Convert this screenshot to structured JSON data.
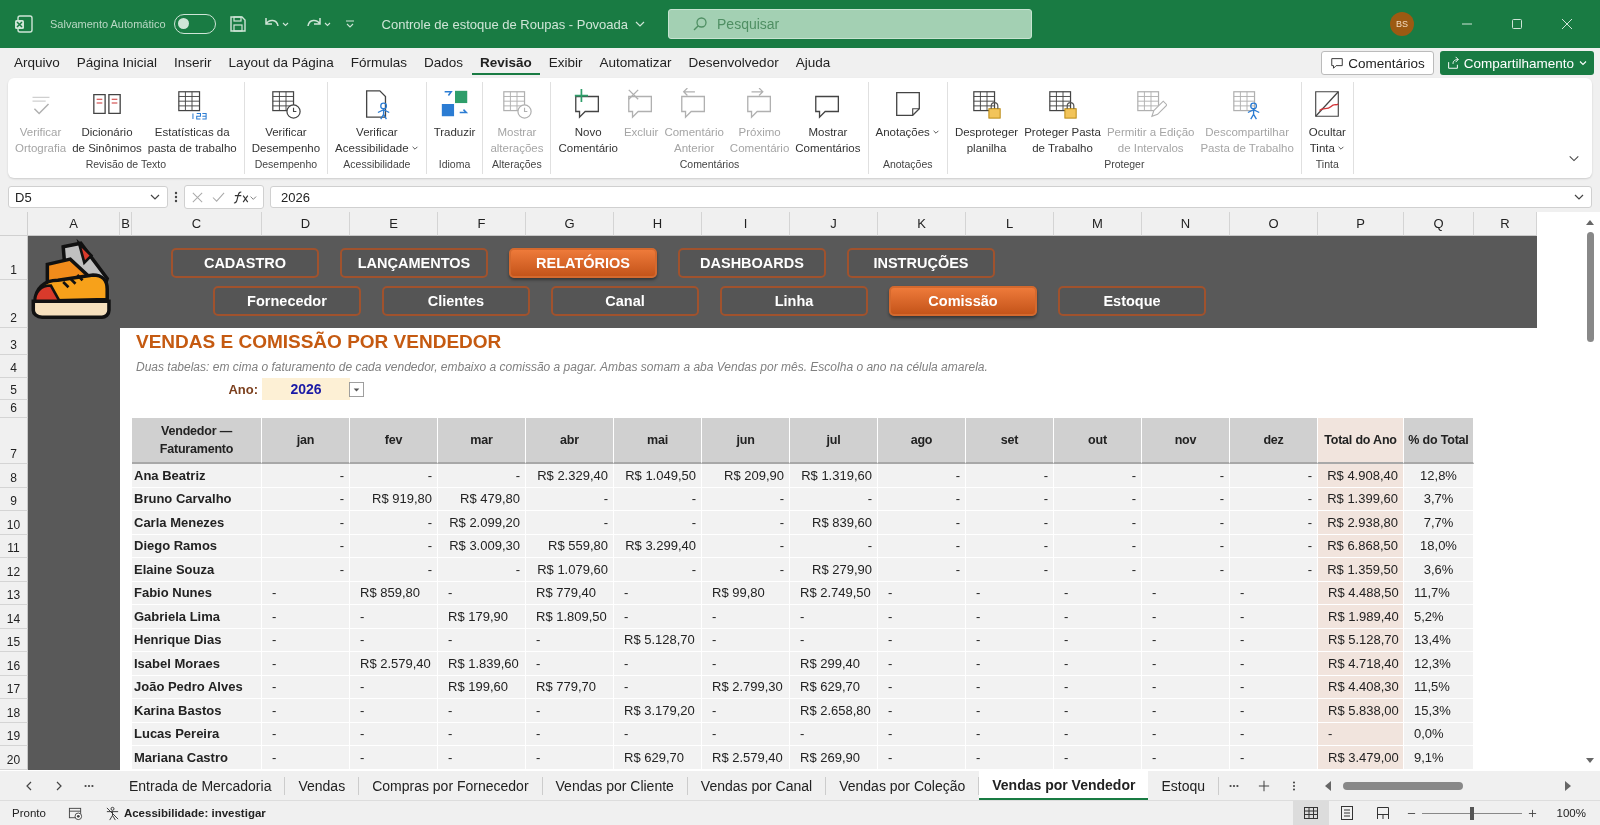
{
  "title_bar": {
    "autosave_label": "Salvamento Automático",
    "autosave_on": false,
    "document_title": "Controle de estoque de Roupas - Povoada",
    "search_placeholder": "Pesquisar",
    "user_initials": "BS"
  },
  "menu": {
    "items": [
      {
        "label": "Arquivo",
        "selected": false
      },
      {
        "label": "Página Inicial",
        "selected": false
      },
      {
        "label": "Inserir",
        "selected": false
      },
      {
        "label": "Layout da Página",
        "selected": false
      },
      {
        "label": "Fórmulas",
        "selected": false
      },
      {
        "label": "Dados",
        "selected": false
      },
      {
        "label": "Revisão",
        "selected": true
      },
      {
        "label": "Exibir",
        "selected": false
      },
      {
        "label": "Automatizar",
        "selected": false
      },
      {
        "label": "Desenvolvedor",
        "selected": false
      },
      {
        "label": "Ajuda",
        "selected": false
      }
    ],
    "comments_button": "Comentários",
    "share_button": "Compartilhamento"
  },
  "ribbon": {
    "groups": [
      {
        "label": "Revisão de Texto",
        "commands": [
          {
            "lines": [
              "Verificar",
              "Ortografia"
            ],
            "kind": "spelling",
            "disabled": true,
            "dropdown": false
          },
          {
            "lines": [
              "Dicionário",
              "de Sinônimos"
            ],
            "kind": "thesaurus",
            "disabled": false,
            "dropdown": false
          },
          {
            "lines": [
              "Estatísticas da",
              "pasta de trabalho"
            ],
            "kind": "statistics",
            "disabled": false,
            "dropdown": false
          }
        ]
      },
      {
        "label": "Desempenho",
        "commands": [
          {
            "lines": [
              "Verificar",
              "Desempenho"
            ],
            "kind": "performance",
            "disabled": false,
            "dropdown": false
          }
        ]
      },
      {
        "label": "Acessibilidade",
        "commands": [
          {
            "lines": [
              "Verificar",
              "Acessibilidade"
            ],
            "kind": "accessibility",
            "disabled": false,
            "dropdown": true
          }
        ]
      },
      {
        "label": "Idioma",
        "commands": [
          {
            "lines": [
              "Traduzir"
            ],
            "kind": "translate",
            "disabled": false,
            "dropdown": false
          }
        ]
      },
      {
        "label": "Alterações",
        "commands": [
          {
            "lines": [
              "Mostrar",
              "alterações"
            ],
            "kind": "changes",
            "disabled": true,
            "dropdown": false
          }
        ]
      },
      {
        "label": "Comentários",
        "commands": [
          {
            "lines": [
              "Novo",
              "Comentário"
            ],
            "kind": "new_comment",
            "disabled": false,
            "dropdown": false
          },
          {
            "lines": [
              "Excluir"
            ],
            "kind": "delete_comment",
            "disabled": true,
            "dropdown": false
          },
          {
            "lines": [
              "Comentário",
              "Anterior"
            ],
            "kind": "previous_comment",
            "disabled": true,
            "dropdown": false
          },
          {
            "lines": [
              "Próximo",
              "Comentário"
            ],
            "kind": "next_comment",
            "disabled": true,
            "dropdown": false
          },
          {
            "lines": [
              "Mostrar",
              "Comentários"
            ],
            "kind": "show_comments",
            "disabled": false,
            "dropdown": false
          }
        ]
      },
      {
        "label": "Anotações",
        "commands": [
          {
            "lines": [
              "Anotações"
            ],
            "kind": "notes",
            "disabled": false,
            "dropdown": true
          }
        ]
      },
      {
        "label": "Proteger",
        "commands": [
          {
            "lines": [
              "Desproteger",
              "planilha"
            ],
            "kind": "unprotect_sheet",
            "disabled": false,
            "dropdown": false
          },
          {
            "lines": [
              "Proteger Pasta",
              "de Trabalho"
            ],
            "kind": "protect_workbook",
            "disabled": false,
            "dropdown": false
          },
          {
            "lines": [
              "Permitir a Edição",
              "de Intervalos"
            ],
            "kind": "allow_edit",
            "disabled": true,
            "dropdown": false
          },
          {
            "lines": [
              "Descompartilhar",
              "Pasta de Trabalho"
            ],
            "kind": "unshare",
            "disabled": true,
            "dropdown": false
          }
        ]
      },
      {
        "label": "Tinta",
        "commands": [
          {
            "lines": [
              "Ocultar",
              "Tinta"
            ],
            "kind": "ink",
            "disabled": false,
            "dropdown": true
          }
        ]
      }
    ]
  },
  "formula_bar": {
    "name_box": "D5",
    "formula": "2026"
  },
  "sheet": {
    "columns": [
      "A",
      "B",
      "C",
      "D",
      "E",
      "F",
      "G",
      "H",
      "I",
      "J",
      "K",
      "L",
      "M",
      "N",
      "O",
      "P",
      "Q",
      "R"
    ],
    "row_numbers": [
      "1",
      "2",
      "3",
      "4",
      "5",
      "6",
      "7",
      "8",
      "9",
      "10",
      "11",
      "12",
      "13",
      "14",
      "15",
      "16",
      "17",
      "18",
      "19",
      "20"
    ],
    "nav_top": [
      {
        "label": "CADASTRO",
        "selected": false
      },
      {
        "label": "LANÇAMENTOS",
        "selected": false
      },
      {
        "label": "RELATÓRIOS",
        "selected": true
      },
      {
        "label": "DASHBOARDS",
        "selected": false
      },
      {
        "label": "INSTRUÇÕES",
        "selected": false
      }
    ],
    "nav_sub": [
      {
        "label": "Fornecedor",
        "selected": false
      },
      {
        "label": "Clientes",
        "selected": false
      },
      {
        "label": "Canal",
        "selected": false
      },
      {
        "label": "Linha",
        "selected": false
      },
      {
        "label": "Comissão",
        "selected": true
      },
      {
        "label": "Estoque",
        "selected": false
      }
    ],
    "heading": "VENDAS E COMISSÃO POR VENDEDOR",
    "note": "Duas tabelas: em cima o faturamento de cada vendedor, embaixo a comissão a pagar. Ambas somam a aba Vendas por mês. Escolha o ano na célula amarela.",
    "year_label": "Ano:",
    "year_value": "2026",
    "table": {
      "columns": [
        "Vendedor — Faturamento",
        "jan",
        "fev",
        "mar",
        "abr",
        "mai",
        "jun",
        "jul",
        "ago",
        "set",
        "out",
        "nov",
        "dez",
        "Total do Ano",
        "% do Total"
      ],
      "rows": [
        {
          "name": "Ana Beatriz",
          "kind": "right",
          "months": [
            "-",
            "-",
            "-",
            "R$ 2.329,40",
            "R$ 1.049,50",
            "R$ 209,90",
            "R$ 1.319,60",
            "-",
            "-",
            "-",
            "-",
            "-"
          ],
          "total": "R$ 4.908,40",
          "share": "12,8%"
        },
        {
          "name": "Bruno Carvalho",
          "kind": "right",
          "months": [
            "-",
            "R$ 919,80",
            "R$ 479,80",
            "-",
            "-",
            "-",
            "-",
            "-",
            "-",
            "-",
            "-",
            "-"
          ],
          "total": "R$ 1.399,60",
          "share": "3,7%"
        },
        {
          "name": "Carla Menezes",
          "kind": "right",
          "months": [
            "-",
            "-",
            "R$ 2.099,20",
            "-",
            "-",
            "-",
            "R$ 839,60",
            "-",
            "-",
            "-",
            "-",
            "-"
          ],
          "total": "R$ 2.938,80",
          "share": "7,7%"
        },
        {
          "name": "Diego Ramos",
          "kind": "right",
          "months": [
            "-",
            "-",
            "R$ 3.009,30",
            "R$ 559,80",
            "R$ 3.299,40",
            "-",
            "-",
            "-",
            "-",
            "-",
            "-",
            "-"
          ],
          "total": "R$ 6.868,50",
          "share": "18,0%"
        },
        {
          "name": "Elaine Souza",
          "kind": "right",
          "months": [
            "-",
            "-",
            "-",
            "R$ 1.079,60",
            "-",
            "-",
            "R$ 279,90",
            "-",
            "-",
            "-",
            "-",
            "-"
          ],
          "total": "R$ 1.359,50",
          "share": "3,6%"
        },
        {
          "name": "Fabio Nunes",
          "kind": "left",
          "months": [
            "-",
            "R$ 859,80",
            "-",
            "R$ 779,40",
            "-",
            "R$ 99,80",
            "R$ 2.749,50",
            "-",
            "-",
            "-",
            "-",
            "-"
          ],
          "total": "R$ 4.488,50",
          "share": "11,7%"
        },
        {
          "name": "Gabriela Lima",
          "kind": "left",
          "months": [
            "-",
            "-",
            "R$ 179,90",
            "R$ 1.809,50",
            "-",
            "-",
            "-",
            "-",
            "-",
            "-",
            "-",
            "-"
          ],
          "total": "R$ 1.989,40",
          "share": "5,2%"
        },
        {
          "name": "Henrique Dias",
          "kind": "left",
          "months": [
            "-",
            "-",
            "-",
            "-",
            "R$ 5.128,70",
            "-",
            "-",
            "-",
            "-",
            "-",
            "-",
            "-"
          ],
          "total": "R$ 5.128,70",
          "share": "13,4%"
        },
        {
          "name": "Isabel Moraes",
          "kind": "left",
          "months": [
            "-",
            "R$ 2.579,40",
            "R$ 1.839,60",
            "-",
            "-",
            "-",
            "R$ 299,40",
            "-",
            "-",
            "-",
            "-",
            "-"
          ],
          "total": "R$ 4.718,40",
          "share": "12,3%"
        },
        {
          "name": "João Pedro Alves",
          "kind": "left",
          "months": [
            "-",
            "-",
            "R$ 199,60",
            "R$ 779,70",
            "-",
            "R$ 2.799,30",
            "R$ 629,70",
            "-",
            "-",
            "-",
            "-",
            "-"
          ],
          "total": "R$ 4.408,30",
          "share": "11,5%"
        },
        {
          "name": "Karina Bastos",
          "kind": "left",
          "months": [
            "-",
            "-",
            "-",
            "-",
            "R$ 3.179,20",
            "-",
            "R$ 2.658,80",
            "-",
            "-",
            "-",
            "-",
            "-"
          ],
          "total": "R$ 5.838,00",
          "share": "15,3%"
        },
        {
          "name": "Lucas Pereira",
          "kind": "left",
          "months": [
            "-",
            "-",
            "-",
            "-",
            "-",
            "-",
            "-",
            "-",
            "-",
            "-",
            "-",
            "-"
          ],
          "total": "-",
          "share": "0,0%"
        },
        {
          "name": "Mariana Castro",
          "kind": "left",
          "months": [
            "-",
            "-",
            "-",
            "-",
            "R$ 629,70",
            "R$ 2.579,40",
            "R$ 269,90",
            "-",
            "-",
            "-",
            "-",
            "-"
          ],
          "total": "R$ 3.479,00",
          "share": "9,1%"
        }
      ]
    }
  },
  "sheet_tabs": [
    {
      "label": "Entrada de Mercadoria",
      "selected": false
    },
    {
      "label": "Vendas",
      "selected": false
    },
    {
      "label": "Compras por Fornecedor",
      "selected": false
    },
    {
      "label": "Vendas por Cliente",
      "selected": false
    },
    {
      "label": "Vendas por Canal",
      "selected": false
    },
    {
      "label": "Vendas por Coleção",
      "selected": false
    },
    {
      "label": "Vendas por Vendedor",
      "selected": true
    },
    {
      "label": "Estoqu",
      "selected": false
    }
  ],
  "status_bar": {
    "ready": "Pronto",
    "accessibility": "Acessibilidade: investigar",
    "zoom_slider": {
      "level": 0.5
    },
    "zoom": "100%"
  }
}
